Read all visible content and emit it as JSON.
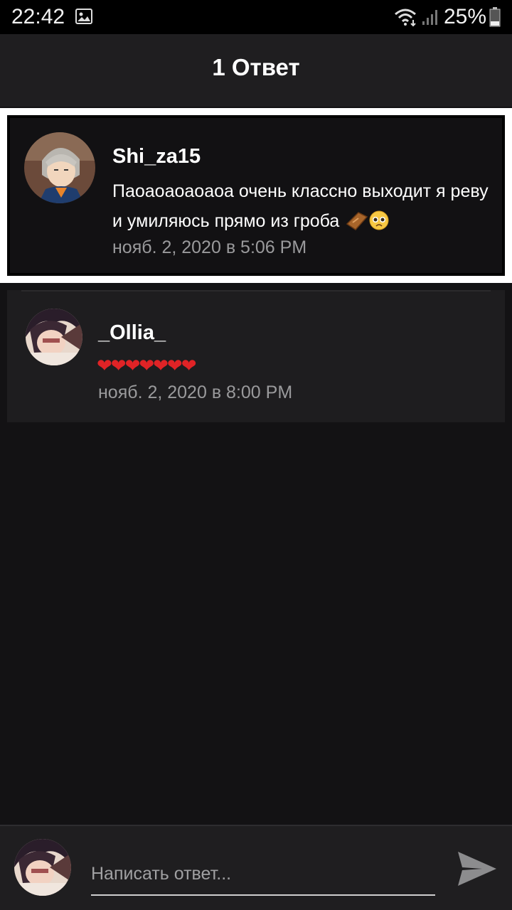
{
  "status_bar": {
    "time": "22:42",
    "battery": "25%",
    "icons": [
      "image-icon",
      "wifi-icon",
      "signal-icon",
      "battery-icon"
    ]
  },
  "header": {
    "title": "1 Ответ"
  },
  "parent_comment": {
    "author": "Shi_za15",
    "text": "Паоаоаоаоаоа очень классно выходит я реву и умиляюсь прямо из гроба",
    "emoji": [
      "coffin-emoji",
      "pleading-face-emoji"
    ],
    "date": "нояб. 2, 2020 в 5:06 PM"
  },
  "replies": [
    {
      "author": "_Ollia_",
      "text": "❤❤❤❤❤❤❤",
      "date": "нояб. 2, 2020 в 8:00 PM"
    }
  ],
  "composer": {
    "placeholder": "Написать ответ...",
    "send_icon": "send-icon"
  },
  "colors": {
    "background": "#131214",
    "header": "#1f1e20",
    "card": "#1e1d1f",
    "highlight_border": "#ffffff",
    "date_text": "#9a9a9c",
    "heart": "#e02326"
  }
}
